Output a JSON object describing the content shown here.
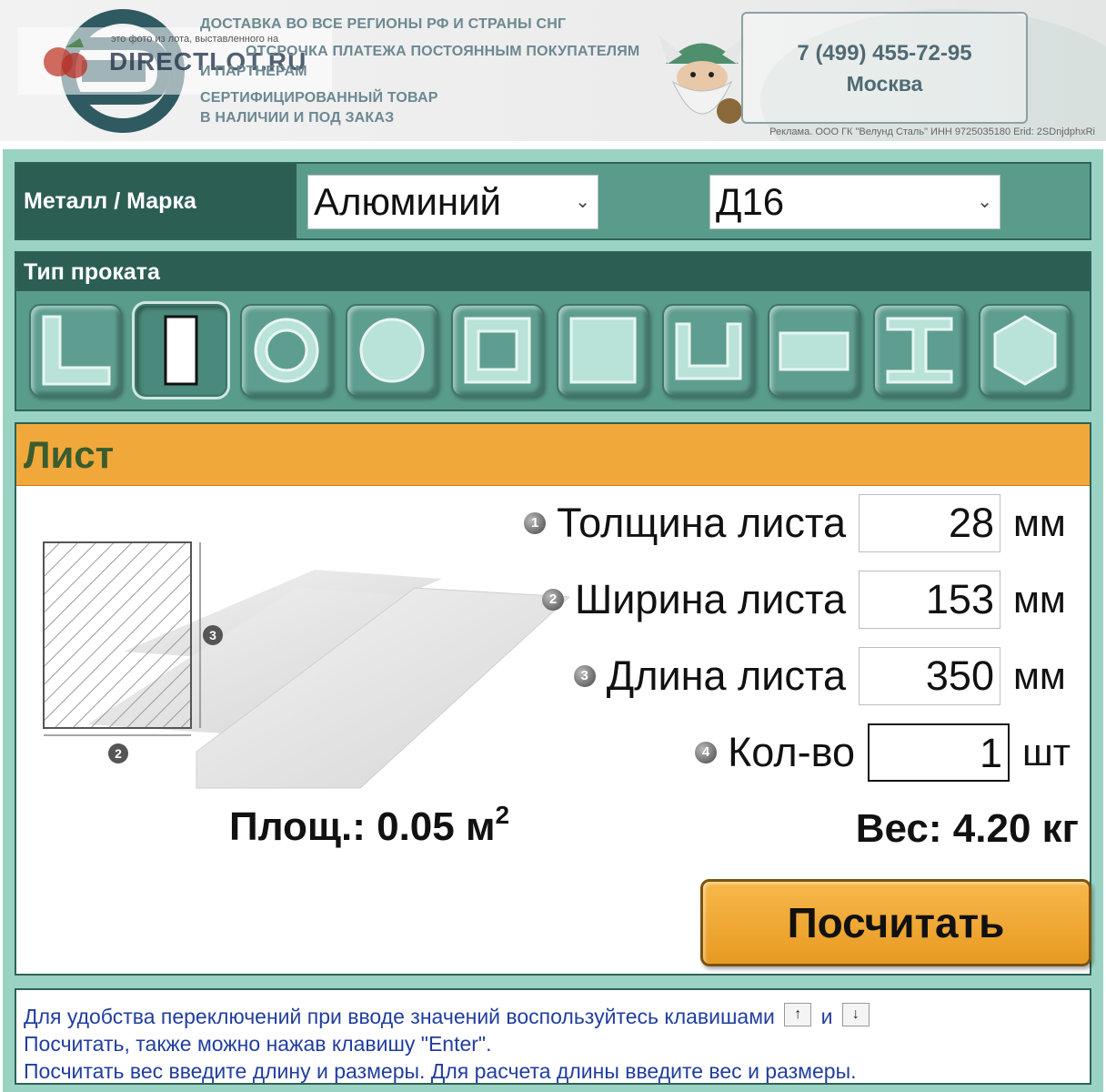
{
  "banner": {
    "watermark_small": "это фото из лота, выставленного на",
    "watermark_big": "DIRECTLOT.RU",
    "line1": "ДОСТАВКА ВО ВСЕ РЕГИОНЫ РФ И СТРАНЫ СНГ",
    "line2": "ОТСРОЧКА ПЛАТЕЖА ПОСТОЯННЫМ ПОКУПАТЕЛЯМ",
    "line3": "И ПАРТНЕРАМ",
    "line4": "СЕРТИФИЦИРОВАННЫЙ ТОВАР",
    "line5": "В НАЛИЧИИ И ПОД ЗАКАЗ",
    "phone": "7 (499) 455-72-95",
    "city": "Москва",
    "note": "Реклама. ООО ГК \"Велунд Сталь\" ИНН 9725035180 Erid: 2SDnjdphxRi"
  },
  "metal": {
    "label": "Металл / Марка",
    "metal_value": "Алюминий",
    "grade_value": "Д16",
    "arrow": "⌄"
  },
  "types": {
    "label": "Тип проката",
    "items": [
      {
        "icon": "angle-profile-icon",
        "selected": false
      },
      {
        "icon": "sheet-profile-icon",
        "selected": true
      },
      {
        "icon": "pipe-profile-icon",
        "selected": false
      },
      {
        "icon": "round-bar-icon",
        "selected": false
      },
      {
        "icon": "square-tube-icon",
        "selected": false
      },
      {
        "icon": "square-bar-icon",
        "selected": false
      },
      {
        "icon": "channel-profile-icon",
        "selected": false
      },
      {
        "icon": "strip-profile-icon",
        "selected": false
      },
      {
        "icon": "i-beam-icon",
        "selected": false
      },
      {
        "icon": "hexagon-bar-icon",
        "selected": false
      }
    ]
  },
  "sheet": {
    "title": "Лист",
    "fields": [
      {
        "num": "1",
        "label": "Толщина листа",
        "value": "28",
        "unit": "мм"
      },
      {
        "num": "2",
        "label": "Ширина листа",
        "value": "153",
        "unit": "мм"
      },
      {
        "num": "3",
        "label": "Длина листа",
        "value": "350",
        "unit": "мм"
      },
      {
        "num": "4",
        "label": "Кол-во",
        "value": "1",
        "unit": "шт"
      }
    ],
    "diagram_label_width": "2",
    "diagram_label_length": "3",
    "area_label": "Площ.: 0.05 м",
    "area_sup": "2",
    "weight": "Вес: 4.20 кг",
    "calc_button": "Посчитать"
  },
  "help": {
    "line1": "Для удобства переключений при вводе значений воспользуйтесь клавишами",
    "key_up": "↑",
    "conj": "и",
    "key_down": "↓",
    "line2": "Посчитать, также можно нажав клавишу \"Enter\".",
    "line3": "Посчитать вес введите длину и размеры. Для расчета длины введите вес и размеры."
  },
  "colors": {
    "frame": "#9ad3c3",
    "panel": "#5a9c8c",
    "header": "#2d5e54",
    "title_bar": "#f1a83a",
    "help_text": "#213e9e"
  }
}
